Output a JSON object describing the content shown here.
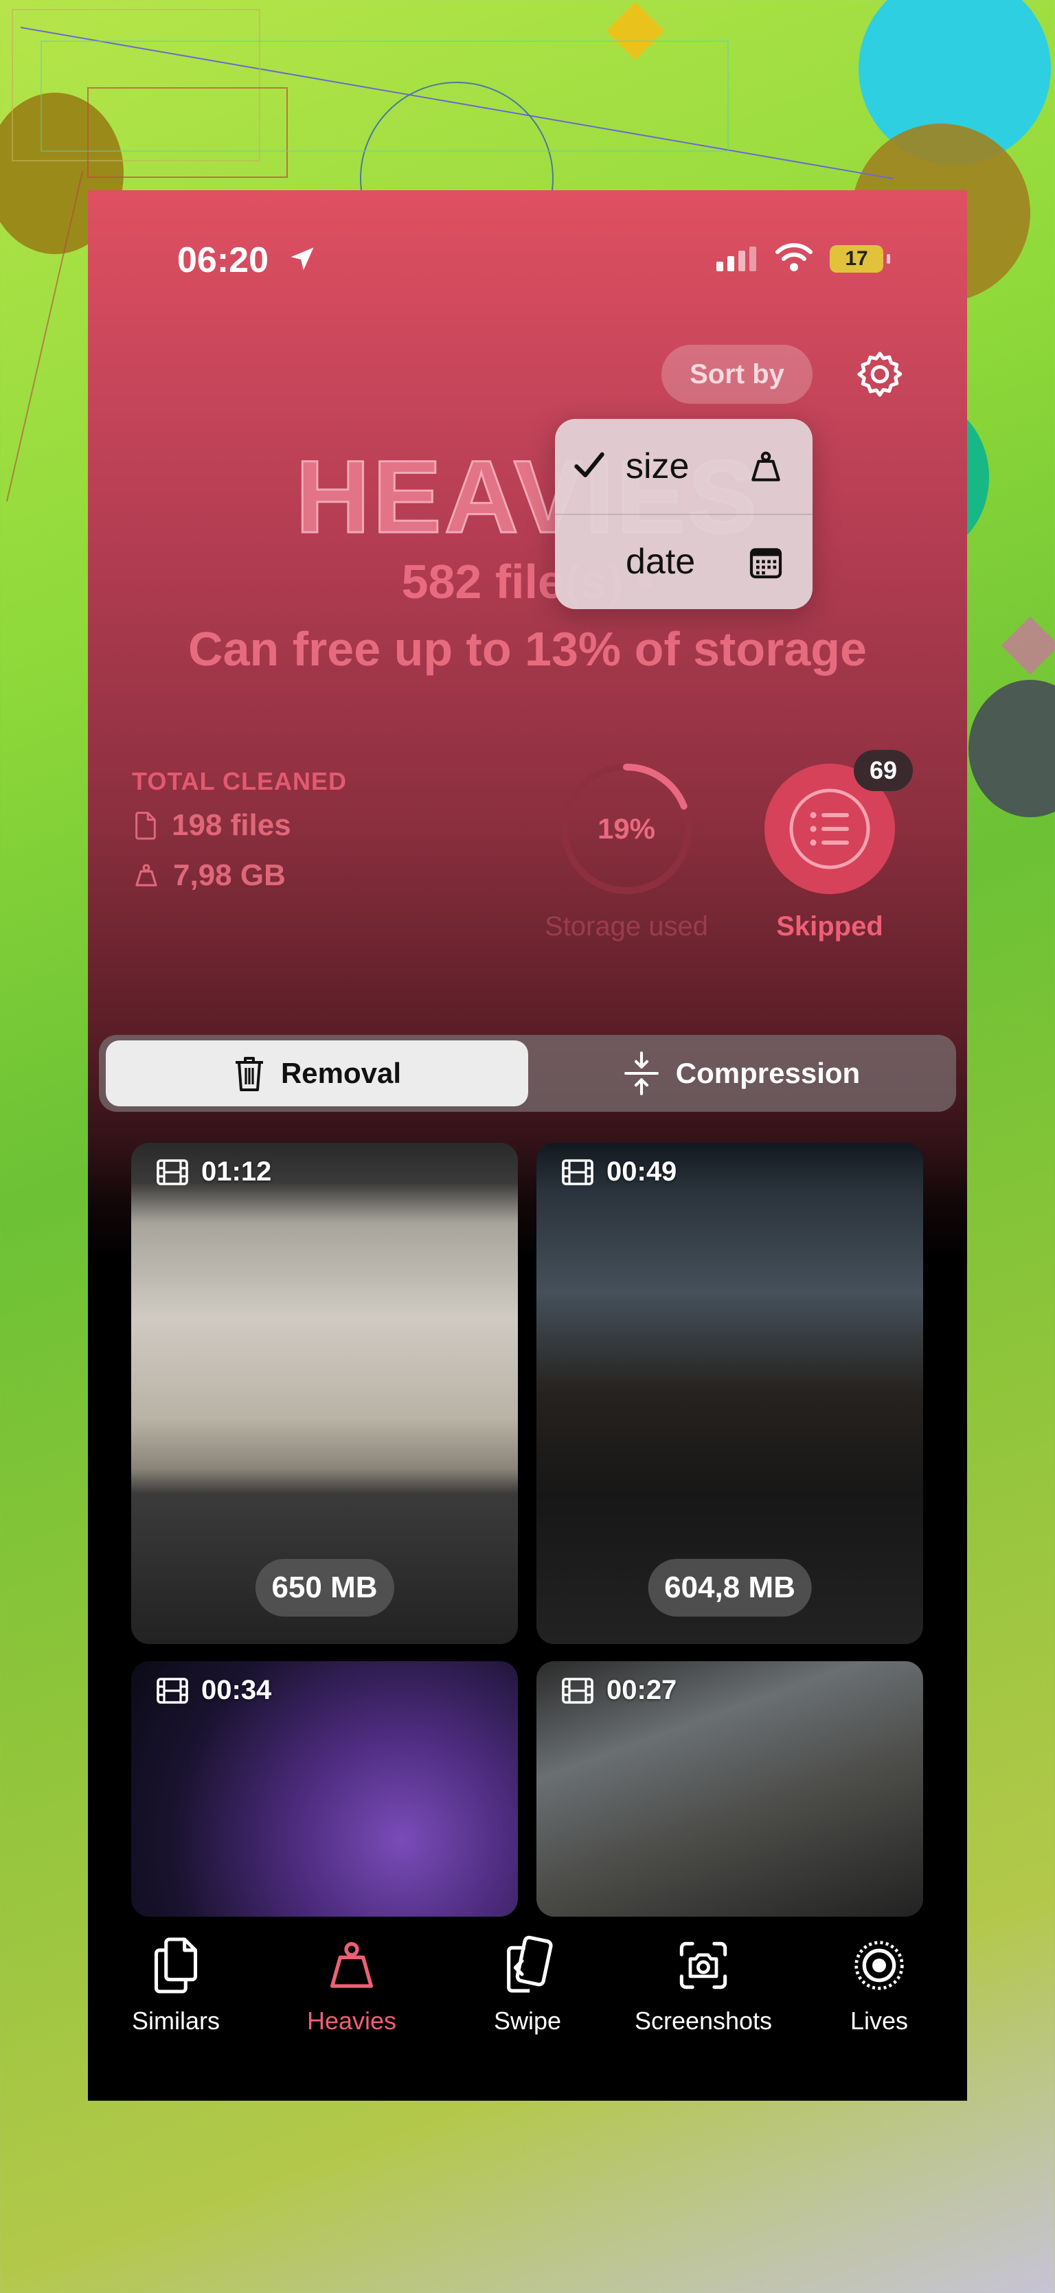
{
  "status_bar": {
    "time": "06:20",
    "battery": "17"
  },
  "header": {
    "sort_label": "Sort by",
    "title": "HEAVIES"
  },
  "summary": {
    "files_line": "582 file(s) •",
    "storage_line": "Can free up to 13% of storage"
  },
  "sort_menu": {
    "items": [
      {
        "label": "size",
        "selected": true,
        "icon": "weight-icon"
      },
      {
        "label": "date",
        "selected": false,
        "icon": "calendar-icon"
      }
    ]
  },
  "stats": {
    "total_cleaned_label": "TOTAL CLEANED",
    "files": "198 files",
    "size": "7,98 GB",
    "storage_percent_label": "19%",
    "storage_used_fraction": 0.19,
    "storage_used_label": "Storage used",
    "skipped_count": "69",
    "skipped_label": "Skipped"
  },
  "segmented": {
    "removal": "Removal",
    "compression": "Compression"
  },
  "media": [
    {
      "duration": "01:12",
      "size": "650 MB"
    },
    {
      "duration": "00:49",
      "size": "604,8 MB"
    },
    {
      "duration": "00:34",
      "size": ""
    },
    {
      "duration": "00:27",
      "size": ""
    }
  ],
  "tab_bar": {
    "items": [
      {
        "label": "Similars",
        "icon": "documents-icon"
      },
      {
        "label": "Heavies",
        "icon": "weight-icon",
        "active": true
      },
      {
        "label": "Swipe",
        "icon": "swipe-cards-icon"
      },
      {
        "label": "Screenshots",
        "icon": "camera-icon"
      },
      {
        "label": "Lives",
        "icon": "live-photo-icon"
      }
    ]
  },
  "colors": {
    "accent": "#ef5f76",
    "header_top": "#df5062",
    "ring": "#e96a80"
  }
}
